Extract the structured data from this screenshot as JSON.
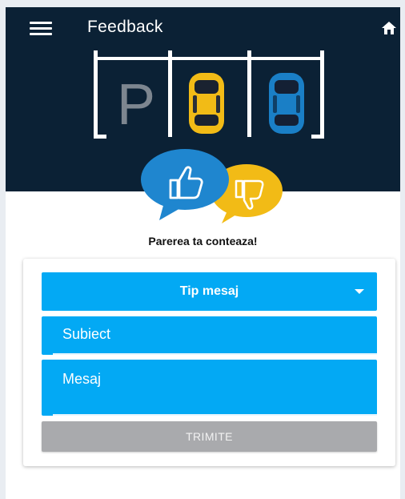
{
  "appbar": {
    "title": "Feedback",
    "menu_icon": "menu-icon",
    "home_icon": "home-icon"
  },
  "hero": {
    "parking_letter": "P",
    "colors": {
      "background": "#0b2135",
      "car_yellow": "#f2bb16",
      "car_blue": "#1a7fc6",
      "bubble_blue": "#1f86cf",
      "bubble_yellow": "#f2bb16"
    }
  },
  "tagline": "Parerea ta conteaza!",
  "form": {
    "type_select": {
      "selected": "Tip mesaj"
    },
    "subject": {
      "placeholder": "Subiect"
    },
    "message": {
      "placeholder": "Mesaj"
    },
    "submit_label": "TRIMITE"
  },
  "colors": {
    "accent": "#03a9f4",
    "submit_disabled": "#a9aaad"
  }
}
